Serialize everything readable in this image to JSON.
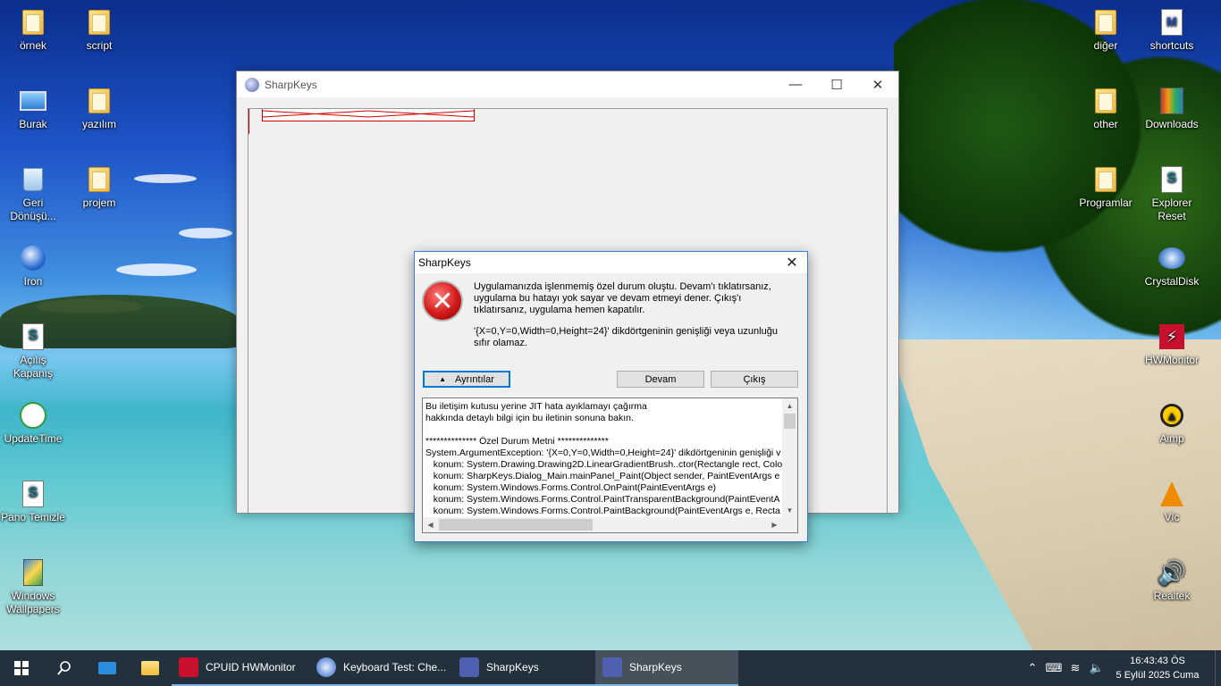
{
  "desktop": {
    "icons_left": [
      {
        "label": "örnek",
        "icon": "folder-icon"
      },
      {
        "label": "script",
        "icon": "folder-icon"
      },
      {
        "label": "Burak",
        "icon": "computer-icon"
      },
      {
        "label": "yazılım",
        "icon": "folder-icon"
      },
      {
        "label": "Geri Dönüşü...",
        "icon": "recycle-bin-icon"
      },
      {
        "label": "projem",
        "icon": "folder-icon"
      },
      {
        "label": "Iron",
        "icon": "iron-browser-icon"
      },
      {
        "label": "Açılış Kapanış",
        "icon": "script-file-icon"
      },
      {
        "label": "UpdateTime",
        "icon": "clock-app-icon"
      },
      {
        "label": "Pano Temizle",
        "icon": "script-file-icon"
      },
      {
        "label": "Windows Wallpapers",
        "icon": "wallpapers-icon"
      }
    ],
    "icons_right": [
      {
        "label": "diğer",
        "icon": "folder-icon"
      },
      {
        "label": "shortcuts",
        "icon": "shortcuts-icon"
      },
      {
        "label": "other",
        "icon": "folder-icon"
      },
      {
        "label": "Downloads",
        "icon": "downloads-icon"
      },
      {
        "label": "Programlar",
        "icon": "folder-icon"
      },
      {
        "label": "Explorer Reset",
        "icon": "script-file-icon"
      },
      {
        "label": "CrystalDisk",
        "icon": "crystaldisk-icon"
      },
      {
        "label": "HWMonitor",
        "icon": "hwmonitor-icon"
      },
      {
        "label": "Aimp",
        "icon": "aimp-icon"
      },
      {
        "label": "Vlc",
        "icon": "vlc-icon"
      },
      {
        "label": "Realtek",
        "icon": "speaker-icon"
      }
    ]
  },
  "main_window": {
    "title": "SharpKeys",
    "minimize": "—",
    "maximize": "☐",
    "close": "✕"
  },
  "dialog": {
    "title": "SharpKeys",
    "close": "✕",
    "message": "Uygulamanızda işlenmemiş özel durum oluştu. Devam'ı tıklatırsanız, uygulama bu hatayı yok sayar ve devam etmeyi dener. Çıkış'ı tıklatırsanız, uygulama hemen kapatılır.",
    "exception": "'{X=0,Y=0,Width=0,Height=24}' dikdörtgeninin genişliği veya uzunluğu sıfır olamaz.",
    "details_button": "Ayrıntılar",
    "continue_button": "Devam",
    "quit_button": "Çıkış",
    "details_text": "Bu iletişim kutusu yerine JIT hata ayıklamayı çağırma\nhakkında detaylı bilgi için bu iletinin sonuna bakın.\n\n************** Özel Durum Metni **************\nSystem.ArgumentException: '{X=0,Y=0,Width=0,Height=24}' dikdörtgeninin genişliği v\n   konum: System.Drawing.Drawing2D.LinearGradientBrush..ctor(Rectangle rect, Colo\n   konum: SharpKeys.Dialog_Main.mainPanel_Paint(Object sender, PaintEventArgs e\n   konum: System.Windows.Forms.Control.OnPaint(PaintEventArgs e)\n   konum: System.Windows.Forms.Control.PaintTransparentBackground(PaintEventA\n   konum: System.Windows.Forms.Control.PaintBackground(PaintEventArgs e, Recta"
  },
  "taskbar": {
    "start_icon": "windows-start-icon",
    "search_icon": "search-icon",
    "apps": [
      {
        "label": "CPUID HWMonitor",
        "icon": "hwmonitor-icon",
        "color": "#c8102e"
      },
      {
        "label": "Keyboard Test: Che...",
        "icon": "iron-browser-icon",
        "color": "#2a64c5"
      },
      {
        "label": "SharpKeys",
        "icon": "sharpkeys-icon",
        "color": "#5060b0"
      },
      {
        "label": "SharpKeys",
        "icon": "sharpkeys-icon",
        "color": "#5060b0"
      }
    ],
    "time": "16:43:43 ÖS",
    "date": "5 Eylül 2025 Cuma"
  }
}
